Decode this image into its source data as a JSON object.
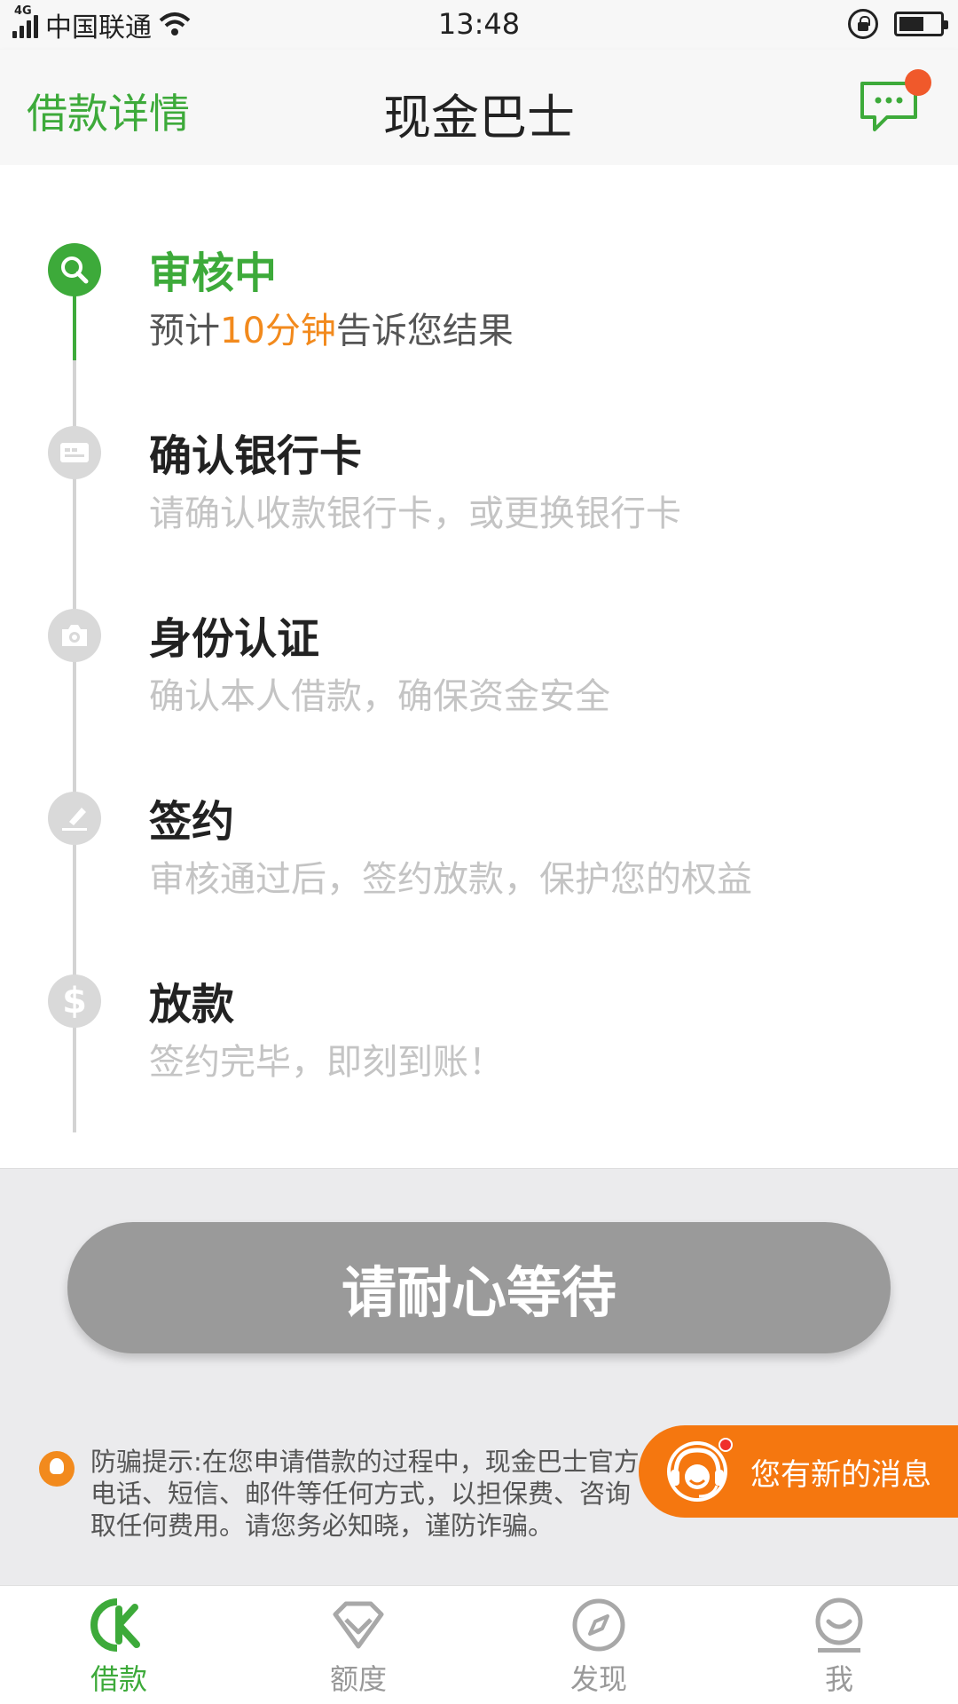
{
  "status_bar": {
    "network": "4G",
    "carrier": "中国联通",
    "time": "13:48"
  },
  "header": {
    "left_label": "借款详情",
    "title": "现金巴士"
  },
  "steps": [
    {
      "title": "审核中",
      "desc_pre": "预计",
      "desc_highlight": "10分钟",
      "desc_post": "告诉您结果",
      "icon": "search-icon",
      "active": true
    },
    {
      "title": "确认银行卡",
      "desc": "请确认收款银行卡，或更换银行卡",
      "icon": "card-icon",
      "active": false
    },
    {
      "title": "身份认证",
      "desc": "确认本人借款，确保资金安全",
      "icon": "camera-icon",
      "active": false
    },
    {
      "title": "签约",
      "desc": "审核通过后，签约放款，保护您的权益",
      "icon": "pen-icon",
      "active": false
    },
    {
      "title": "放款",
      "desc": "签约完毕，即刻到账！",
      "icon": "dollar-icon",
      "active": false
    }
  ],
  "wait_button": "请耐心等待",
  "tip": {
    "line1": "防骗提示:在您申请借款的过程中，现金巴士官方",
    "line2": "电话、短信、邮件等任何方式，以担保费、咨询",
    "line3": "取任何费用。请您务必知晓，谨防诈骗。"
  },
  "toast": {
    "label": "您有新的消息"
  },
  "tabs": [
    {
      "label": "借款",
      "icon": "loan-icon",
      "active": true
    },
    {
      "label": "额度",
      "icon": "diamond-icon",
      "active": false
    },
    {
      "label": "发现",
      "icon": "compass-icon",
      "active": false
    },
    {
      "label": "我",
      "icon": "smile-icon",
      "active": false
    }
  ],
  "colors": {
    "brand_green": "#3daa3a",
    "accent_orange": "#f28a1d",
    "toast_orange": "#f5770f",
    "badge_red": "#f0592b",
    "button_gray": "#9a9a9a"
  }
}
